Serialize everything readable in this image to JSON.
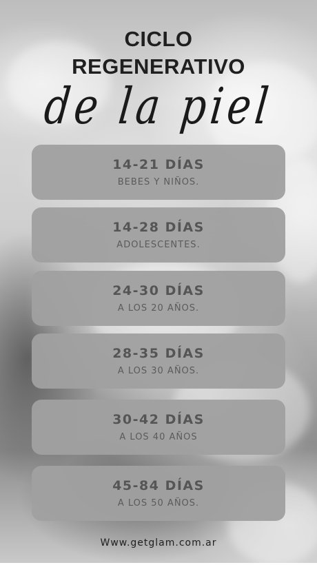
{
  "title": {
    "line1": "CICLO",
    "line2": "REGENERATIVO",
    "script": "de la piel"
  },
  "cards": [
    {
      "range": "14-21 DÍAS",
      "label": "BEBES Y NIÑOS."
    },
    {
      "range": "14-28 DÍAS",
      "label": "ADOLESCENTES."
    },
    {
      "range": "24-30 DÍAS",
      "label": "A LOS 20 AÑOS."
    },
    {
      "range": "28-35 DÍAS",
      "label": "A LOS 30 AÑOS."
    },
    {
      "range": "30-42 DÍAS",
      "label": "A LOS 40 AÑOS"
    },
    {
      "range": "45-84 DÍAS",
      "label": "A LOS 50 AÑOS."
    }
  ],
  "footer": {
    "url": "Www.getglam.com.ar"
  },
  "colors": {
    "card_background": "#a0a0a0",
    "card_text": "#555555",
    "title_text": "#1f1f1f"
  }
}
